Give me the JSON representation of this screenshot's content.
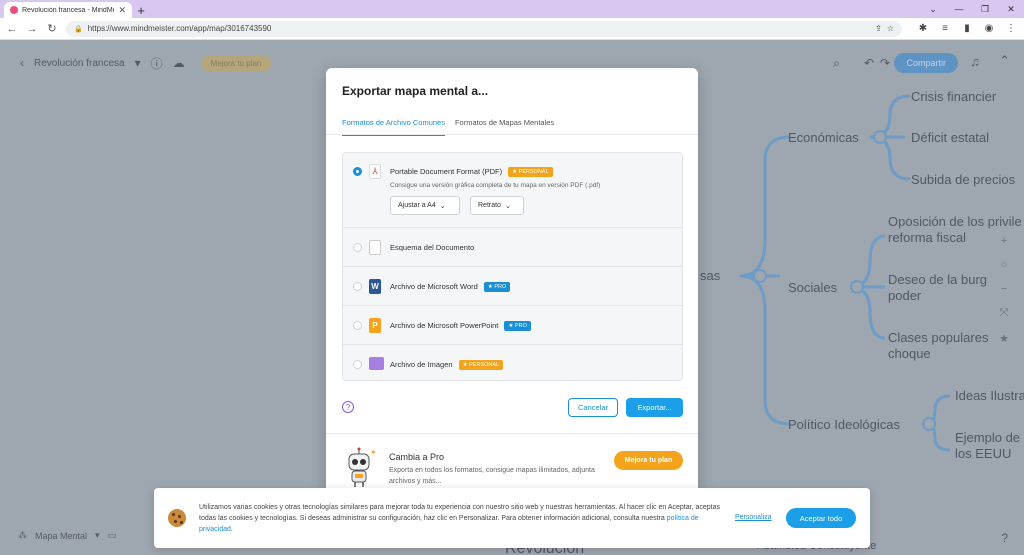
{
  "browser": {
    "tab_title": "Revolución francesa - MindMeis...",
    "url": "https://www.mindmeister.com/app/map/3016743590"
  },
  "app": {
    "map_name": "Revolución francesa",
    "upgrade_label": "Mejora tu plan",
    "share_label": "Compartir",
    "bottom_mode": "Mapa Mental",
    "mindmap": {
      "center_partial": "sas",
      "branches": [
        "Económicas",
        "Sociales",
        "Político Ideológicas"
      ],
      "economicas": [
        "Crisis financier",
        "Déficit estatal",
        "Subida de precios"
      ],
      "sociales": [
        "Oposición de los privile",
        "reforma fiscal",
        "Deseo de la burg",
        "poder",
        "Clases populares",
        "choque"
      ],
      "politico": [
        "Ideas Ilustra",
        "Ejemplo de",
        "los EEUU"
      ],
      "bottom_partial": "Revolución",
      "bottom_right_partial": "Asamblea Constituyente"
    }
  },
  "modal": {
    "title": "Exportar mapa mental a...",
    "tabs": [
      "Formatos de Archivo Comunes",
      "Formatos de Mapas Mentales"
    ],
    "options": [
      {
        "label": "Portable Document Format (PDF)",
        "badge": "PERSONAL",
        "desc": "Consigue una versión gráfica completa de tu mapa en versión PDF (.pdf)"
      },
      {
        "label": "Esquema del Documento"
      },
      {
        "label": "Archivo de Microsoft Word",
        "badge": "PRO"
      },
      {
        "label": "Archivo de Microsoft PowerPoint",
        "badge": "PRO"
      },
      {
        "label": "Archivo de Imagen",
        "badge": "PERSONAL"
      }
    ],
    "select_fit": "Ajustar a A4",
    "select_orientation": "Retrato",
    "cancel_label": "Cancelar",
    "export_label": "Exportar...",
    "promo_title": "Cambia a Pro",
    "promo_desc": "Exporta en todos los formatos, consigue mapas ilimitados, adjunta archivos y más...",
    "promo_button": "Mejora tu plan"
  },
  "cookie": {
    "text": "Utilizamos varias cookies y otras tecnologías similares para mejorar toda tu experiencia con nuestro sitio web y nuestras herramientas. Al hacer clic en Aceptar, aceptas todas las cookies y tecnologías. Si deseas administrar su configuración, haz clic en Personalizar. Para obtener información adicional, consulta nuestra",
    "link": "política de privacidad",
    "personalize": "Personaliza",
    "accept": "Aceptar todo"
  },
  "colors": {
    "accent": "#1a8fd6",
    "personal": "#f4a31c",
    "pro": "#1a8fd6"
  }
}
